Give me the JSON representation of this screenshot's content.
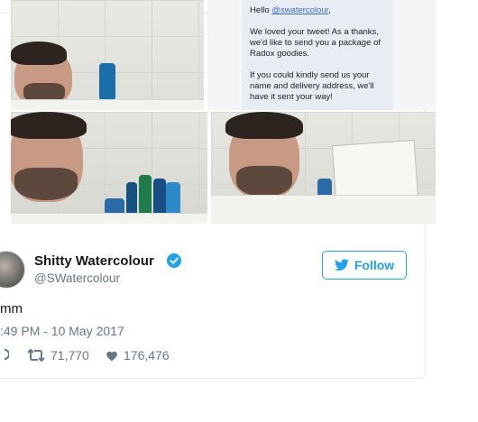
{
  "dm": {
    "greeting": "Hello",
    "handle_link": "@swatercolour",
    "greeting_end": ",",
    "paragraph1": "We loved your tweet! As a thanks, we'd like to send you a package of Radox goodies.",
    "paragraph2": "If you could kindly send us your name and delivery address, we'll have it sent your way!"
  },
  "profile": {
    "name": "Shitty Watercolour",
    "handle": "@SWatercolour",
    "follow_label": "Follow"
  },
  "tweet": {
    "text": "mm",
    "timestamp": ":49 PM - 10 May 2017"
  },
  "stats": {
    "retweets": "71,770",
    "likes": "176,476"
  },
  "colors": {
    "accent": "#1da1f2",
    "muted": "#657786",
    "text": "#14171a",
    "border": "#e1e8ed"
  },
  "icons": [
    "verified-badge-icon",
    "twitter-bird-icon",
    "reply-icon",
    "retweet-icon",
    "heart-icon"
  ]
}
